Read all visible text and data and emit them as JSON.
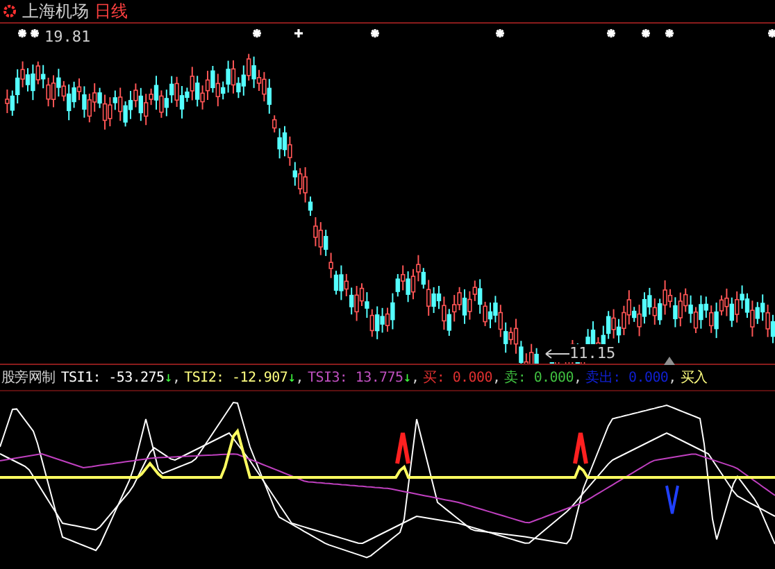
{
  "header": {
    "stock": "上海机场",
    "period": "日线"
  },
  "price_chart": {
    "high_label": "19.81",
    "low_label": "11.15"
  },
  "indicator": {
    "name": "股旁网制",
    "values": [
      {
        "label": "TSI1:",
        "value": "-53.275",
        "arrow": "↓",
        "separator": ",",
        "color": "#ffffff"
      },
      {
        "label": "TSI2:",
        "value": "-12.907",
        "arrow": "↓",
        "separator": ",",
        "color": "#ffff80"
      },
      {
        "label": "TSI3:",
        "value": "13.775",
        "arrow": "↓",
        "separator": ",",
        "color": "#c050c0"
      },
      {
        "label": "买:",
        "value": "0.000",
        "separator": ",",
        "color": "#e03030"
      },
      {
        "label": "卖:",
        "value": "0.000",
        "separator": ",",
        "color": "#40c040"
      },
      {
        "label": "卖出:",
        "value": "0.000",
        "separator": ",",
        "color": "#1020d0"
      }
    ],
    "trailing": "买入"
  }
}
